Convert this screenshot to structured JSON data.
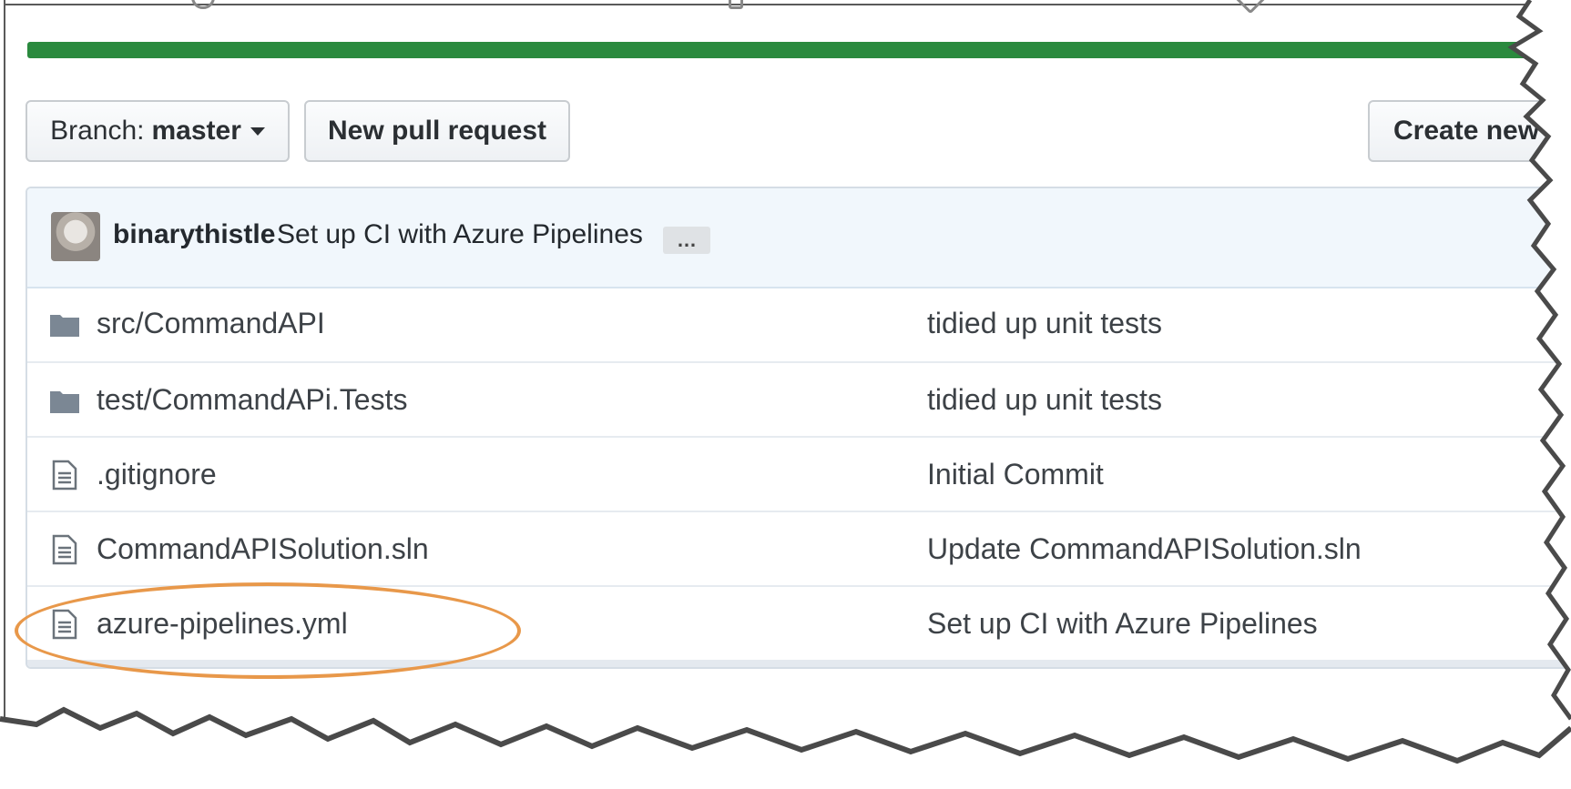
{
  "toolbar": {
    "branch_prefix": "Branch:",
    "branch_value": "master",
    "new_pull_request": "New pull request",
    "create_new": "Create new"
  },
  "latest_commit": {
    "author": "binarythistle",
    "message": "Set up CI with Azure Pipelines",
    "more": "…"
  },
  "files": [
    {
      "type": "folder",
      "name": "src/CommandAPI",
      "message": "tidied up unit tests"
    },
    {
      "type": "folder",
      "name": "test/CommandAPi.Tests",
      "message": "tidied up unit tests"
    },
    {
      "type": "file",
      "name": ".gitignore",
      "message": "Initial Commit"
    },
    {
      "type": "file",
      "name": "CommandAPISolution.sln",
      "message": "Update CommandAPISolution.sln"
    },
    {
      "type": "file",
      "name": "azure-pipelines.yml",
      "message": "Set up CI with Azure Pipelines"
    }
  ],
  "colors": {
    "language_bar": "#2a8a3e",
    "highlight_ring": "#e8984a",
    "header_bg": "#f1f7fc"
  }
}
